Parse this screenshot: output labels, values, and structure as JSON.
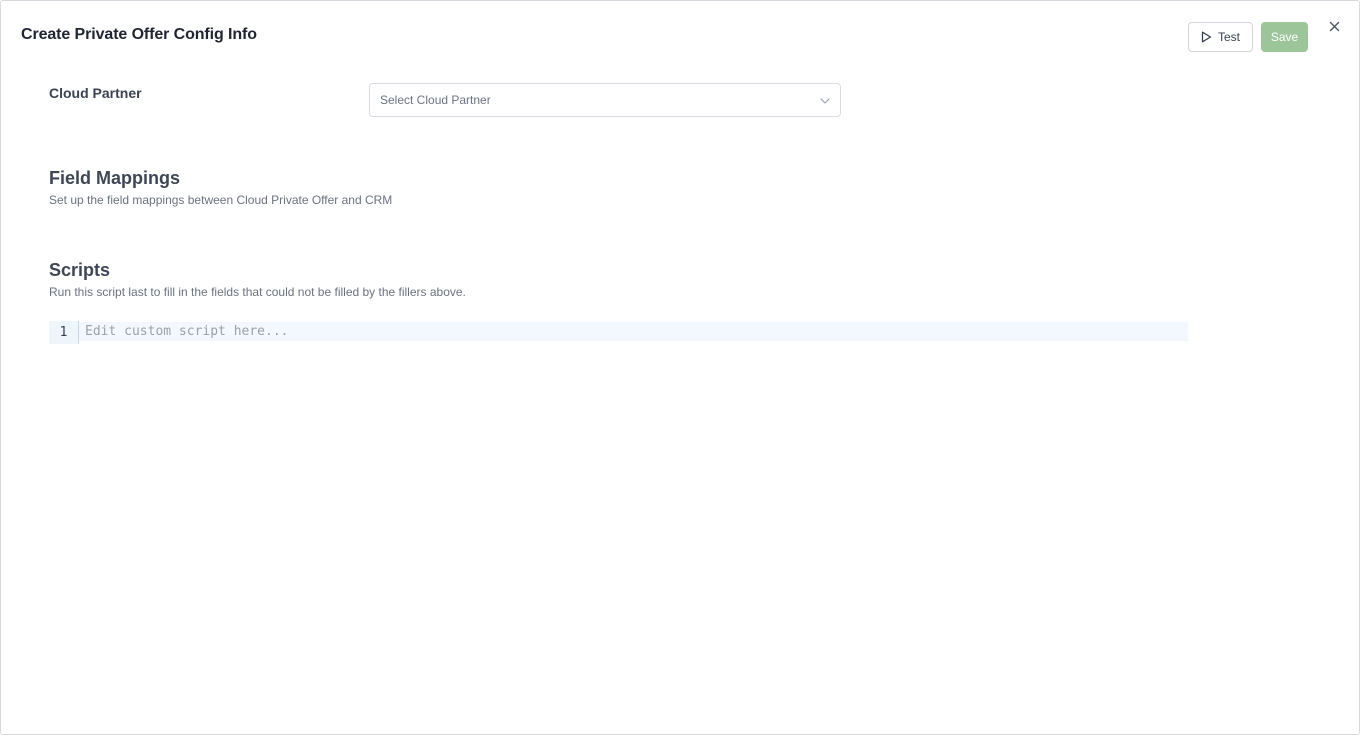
{
  "modal": {
    "title": "Create Private Offer Config Info",
    "test_label": "Test",
    "save_label": "Save"
  },
  "cloud_partner": {
    "label": "Cloud Partner",
    "placeholder": "Select Cloud Partner"
  },
  "field_mappings": {
    "title": "Field Mappings",
    "description": "Set up the field mappings between Cloud Private Offer and CRM"
  },
  "scripts": {
    "title": "Scripts",
    "description": "Run this script last to fill in the fields that could not be filled by the fillers above.",
    "line_number": "1",
    "editor_placeholder": "Edit custom script here..."
  },
  "colors": {
    "save_button_bg": "#9cc59a",
    "editor_line_bg": "#f2f8fd",
    "gutter_bg": "#eef5fb"
  },
  "icons": {
    "test": "play-icon",
    "close": "close-icon",
    "select": "chevron-down-icon"
  }
}
